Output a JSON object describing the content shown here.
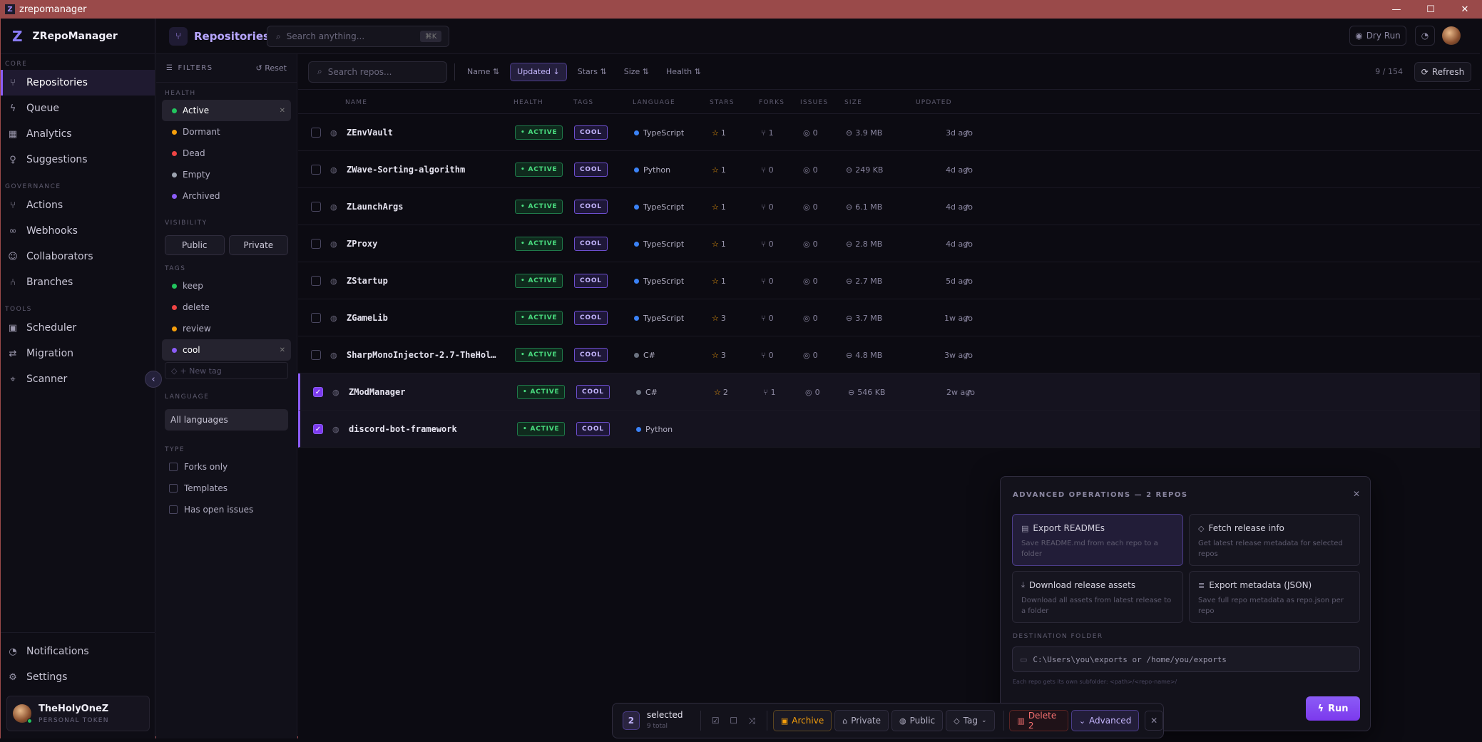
{
  "window": {
    "title": "zrepomanager"
  },
  "brand": {
    "name": "ZRepoManager",
    "logo": "Z"
  },
  "sidebar": {
    "sections": {
      "core": "CORE",
      "governance": "GOVERNANCE",
      "tools": "TOOLS"
    },
    "core": [
      {
        "label": "Repositories",
        "icon": "repo-icon"
      },
      {
        "label": "Queue",
        "icon": "bolt-icon"
      },
      {
        "label": "Analytics",
        "icon": "chart-icon"
      },
      {
        "label": "Suggestions",
        "icon": "bulb-icon"
      }
    ],
    "governance": [
      {
        "label": "Actions",
        "icon": "branch-icon"
      },
      {
        "label": "Webhooks",
        "icon": "webhook-icon"
      },
      {
        "label": "Collaborators",
        "icon": "users-icon"
      },
      {
        "label": "Branches",
        "icon": "git-branch-icon"
      }
    ],
    "tools": [
      {
        "label": "Scheduler",
        "icon": "calendar-icon"
      },
      {
        "label": "Migration",
        "icon": "swap-icon"
      },
      {
        "label": "Scanner",
        "icon": "scan-icon"
      }
    ],
    "bottom": [
      {
        "label": "Notifications",
        "icon": "bell-icon"
      },
      {
        "label": "Settings",
        "icon": "gear-icon"
      }
    ],
    "user": {
      "name": "TheHolyOneZ",
      "sub": "PERSONAL TOKEN"
    }
  },
  "topbar": {
    "title": "Repositories",
    "search_placeholder": "Search anything...",
    "kbd": "⌘K",
    "dry_run": "Dry Run"
  },
  "filters": {
    "title": "FILTERS",
    "reset": "Reset",
    "health_label": "HEALTH",
    "health": [
      {
        "label": "Active",
        "color": "#22c55e"
      },
      {
        "label": "Dormant",
        "color": "#f59e0b"
      },
      {
        "label": "Dead",
        "color": "#ef4444"
      },
      {
        "label": "Empty",
        "color": "#9ca3af"
      },
      {
        "label": "Archived",
        "color": "#8b5cf6"
      }
    ],
    "visibility_label": "VISIBILITY",
    "visibility": [
      "Public",
      "Private"
    ],
    "tags_label": "TAGS",
    "tags": [
      {
        "label": "keep",
        "color": "#22c55e"
      },
      {
        "label": "delete",
        "color": "#ef4444"
      },
      {
        "label": "review",
        "color": "#f59e0b"
      },
      {
        "label": "cool",
        "color": "#8b5cf6"
      }
    ],
    "new_tag_placeholder": "+ New tag",
    "language_label": "LANGUAGE",
    "language_value": "All languages",
    "type_label": "TYPE",
    "types": [
      "Forks only",
      "Templates",
      "Has open issues"
    ]
  },
  "toolbar": {
    "search_placeholder": "Search repos...",
    "sorts": [
      "Name ⇅",
      "Updated ↓",
      "Stars ⇅",
      "Size ⇅",
      "Health ⇅"
    ],
    "count": "9 / 154",
    "refresh": "Refresh"
  },
  "table": {
    "headers": [
      "NAME",
      "HEALTH",
      "TAGS",
      "LANGUAGE",
      "STARS",
      "FORKS",
      "ISSUES",
      "SIZE",
      "UPDATED"
    ],
    "rows": [
      {
        "name": "ZEnvVault",
        "health": "• ACTIVE",
        "tag": "COOL",
        "language": "TypeScript",
        "lang_color": "#3b82f6",
        "stars": "1",
        "forks": "1",
        "issues": "0",
        "size": "3.9 MB",
        "updated": "3d ago",
        "selected": false
      },
      {
        "name": "ZWave-Sorting-algorithm",
        "health": "• ACTIVE",
        "tag": "COOL",
        "language": "Python",
        "lang_color": "#3b82f6",
        "stars": "1",
        "forks": "0",
        "issues": "0",
        "size": "249 KB",
        "updated": "4d ago",
        "selected": false
      },
      {
        "name": "ZLaunchArgs",
        "health": "• ACTIVE",
        "tag": "COOL",
        "language": "TypeScript",
        "lang_color": "#3b82f6",
        "stars": "1",
        "forks": "0",
        "issues": "0",
        "size": "6.1 MB",
        "updated": "4d ago",
        "selected": false
      },
      {
        "name": "ZProxy",
        "health": "• ACTIVE",
        "tag": "COOL",
        "language": "TypeScript",
        "lang_color": "#3b82f6",
        "stars": "1",
        "forks": "0",
        "issues": "0",
        "size": "2.8 MB",
        "updated": "4d ago",
        "selected": false
      },
      {
        "name": "ZStartup",
        "health": "• ACTIVE",
        "tag": "COOL",
        "language": "TypeScript",
        "lang_color": "#3b82f6",
        "stars": "1",
        "forks": "0",
        "issues": "0",
        "size": "2.7 MB",
        "updated": "5d ago",
        "selected": false
      },
      {
        "name": "ZGameLib",
        "health": "• ACTIVE",
        "tag": "COOL",
        "language": "TypeScript",
        "lang_color": "#3b82f6",
        "stars": "3",
        "forks": "0",
        "issues": "0",
        "size": "3.7 MB",
        "updated": "1w ago",
        "selected": false
      },
      {
        "name": "SharpMonoInjector-2.7-TheHol…",
        "health": "• ACTIVE",
        "tag": "COOL",
        "language": "C#",
        "lang_color": "#6b7280",
        "stars": "3",
        "forks": "0",
        "issues": "0",
        "size": "4.8 MB",
        "updated": "3w ago",
        "selected": false
      },
      {
        "name": "ZModManager",
        "health": "• ACTIVE",
        "tag": "COOL",
        "language": "C#",
        "lang_color": "#6b7280",
        "stars": "2",
        "forks": "1",
        "issues": "0",
        "size": "546 KB",
        "updated": "2w ago",
        "selected": true
      },
      {
        "name": "discord-bot-framework",
        "health": "• ACTIVE",
        "tag": "COOL",
        "language": "Python",
        "lang_color": "#3b82f6",
        "stars": "",
        "forks": "",
        "issues": "",
        "size": "",
        "updated": "",
        "selected": true
      }
    ]
  },
  "advanced": {
    "title": "ADVANCED OPERATIONS — 2 REPOS",
    "ops": [
      {
        "title": "Export READMEs",
        "desc": "Save README.md from each repo to a folder",
        "icon": "document-icon"
      },
      {
        "title": "Fetch release info",
        "desc": "Get latest release metadata for selected repos",
        "icon": "tag-icon"
      },
      {
        "title": "Download release assets",
        "desc": "Download all assets from latest release to a folder",
        "icon": "download-icon"
      },
      {
        "title": "Export metadata (JSON)",
        "desc": "Save full repo metadata as repo.json per repo",
        "icon": "database-icon"
      }
    ],
    "dest_label": "DESTINATION FOLDER",
    "dest_placeholder": "C:\\Users\\you\\exports or /home/you/exports",
    "dest_hint": "Each repo gets its own subfolder: <path>/<repo-name>/",
    "run": "Run"
  },
  "bulk": {
    "count": "2",
    "selected": "selected",
    "total": "9 total",
    "archive": "Archive",
    "private": "Private",
    "public": "Public",
    "tag": "Tag",
    "delete": "Delete 2",
    "advanced": "Advanced"
  }
}
